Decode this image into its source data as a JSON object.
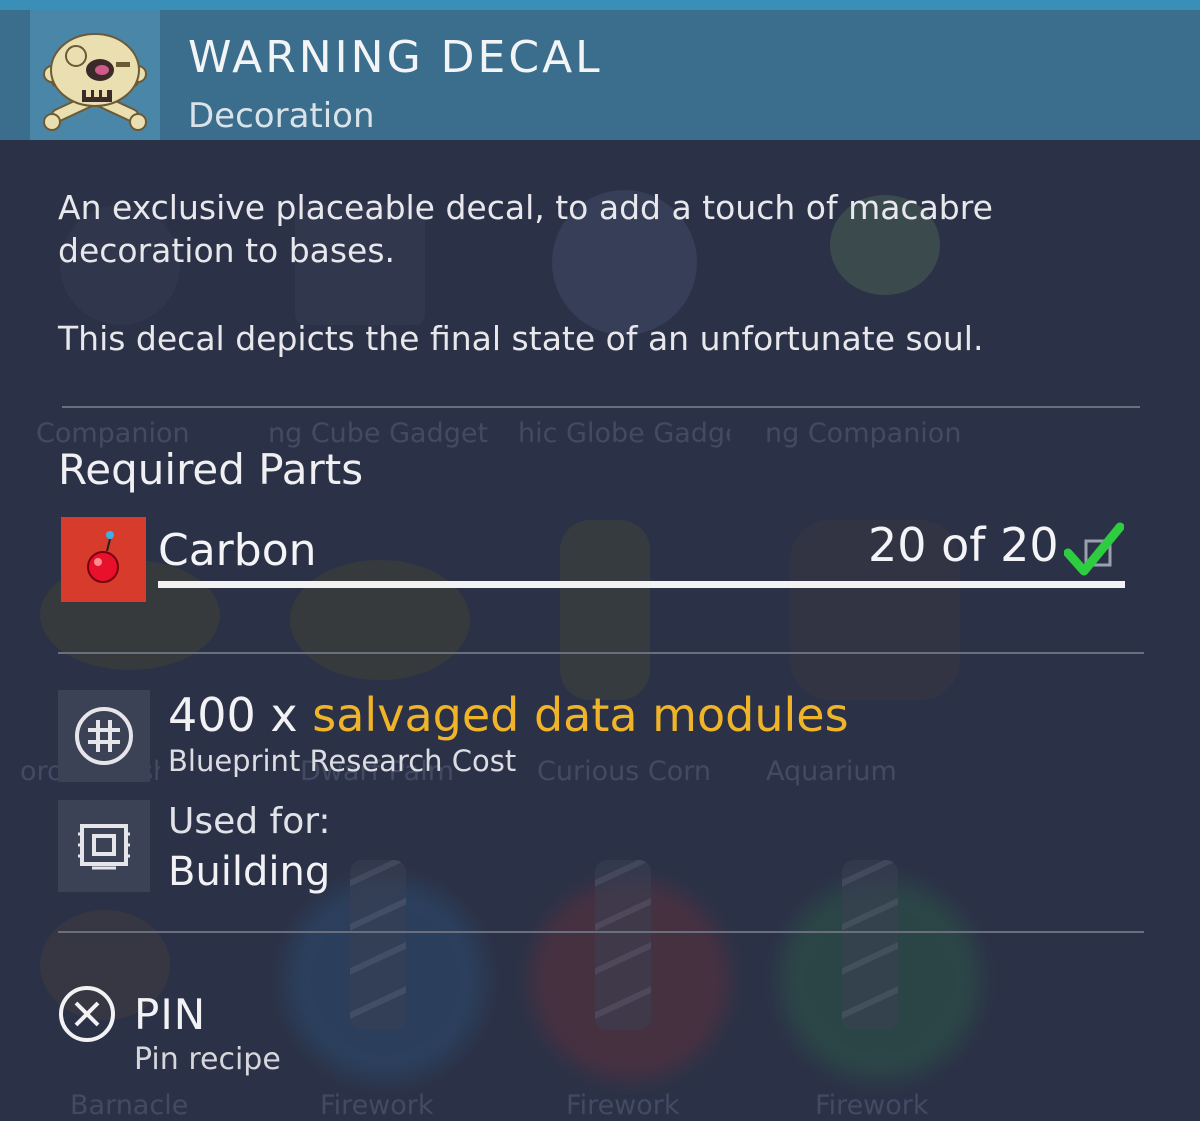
{
  "item": {
    "title": "WARNING DECAL",
    "category": "Decoration",
    "description": [
      "An exclusive placeable decal, to add a touch of macabre decoration to bases.",
      "This decal depicts the final state of an unfortunate soul."
    ],
    "icon": "skull-crossbones-decal-icon"
  },
  "required_parts": {
    "title": "Required Parts",
    "items": [
      {
        "name": "Carbon",
        "count": "20 of 20",
        "icon": "carbon-element-icon",
        "complete": true,
        "progress": 1.0
      }
    ]
  },
  "research": {
    "quantity": "400 x",
    "resource": "salvaged data modules",
    "label": "Blueprint Research Cost",
    "icon": "blueprint-research-icon"
  },
  "usage": {
    "label": "Used for:",
    "value": "Building",
    "icon": "building-chip-icon"
  },
  "action": {
    "label": "PIN",
    "sublabel": "Pin recipe",
    "icon": "cross-button-icon"
  },
  "background_catalog": {
    "labels_row1": [
      "Companion",
      "ng Cube Gadget",
      "hic Globe Gadge",
      "ng Companion"
    ],
    "labels_row2": [
      "orous Bush",
      "Dwarf Palm",
      "Curious Corn",
      "Aquarium"
    ],
    "labels_row3": [
      "Barnacle",
      "Firework",
      "Firework",
      "Firework"
    ]
  },
  "colors": {
    "header": "#3b6d8c",
    "panel": "#2b3247",
    "accent_gold": "#f0b429",
    "carbon_red": "#d63b2c",
    "check_green": "#2ecc40"
  }
}
